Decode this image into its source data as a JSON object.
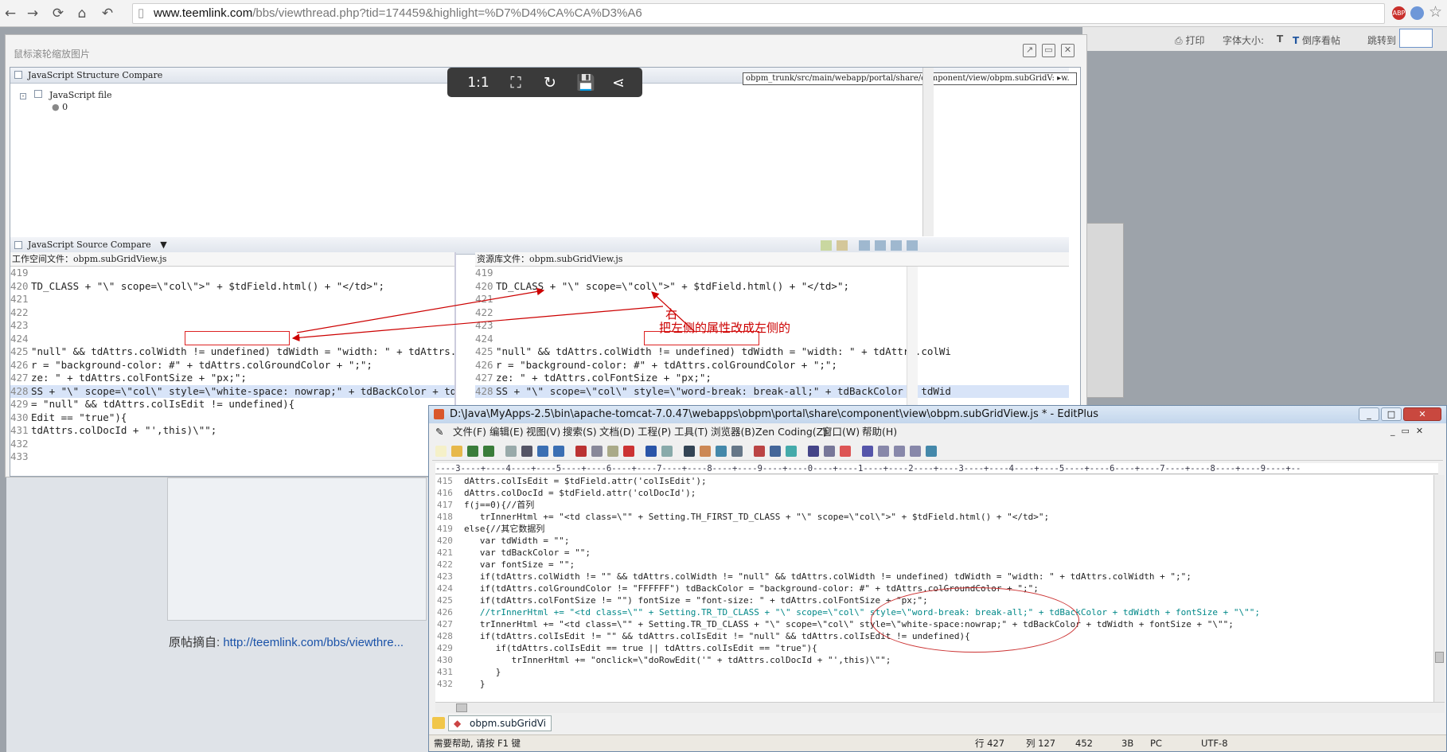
{
  "browser": {
    "url_host": "www.teemlink.com",
    "url_path": "/bbs/viewthread.php?tid=174459&highlight=%D7%D4%CA%CA%D3%A6"
  },
  "page": {
    "print": "打印",
    "font_size": "字体大小:",
    "font_t": "T",
    "reverse": "倒序看帖",
    "jump": "跳转到",
    "source_label": "原帖摘自:",
    "source_link": "http://teemlink.com/bbs/viewthre..."
  },
  "viewer": {
    "hint": "鼠标滚轮缩放图片",
    "toolbar": {
      "ratio": "1:1"
    }
  },
  "eclipse": {
    "structure_title": "JavaScript Structure Compare",
    "path": "obpm_trunk/src/main/webapp/portal/share/component/view/obpm.subGridV: ▸w.",
    "tree_root": "JavaScript file",
    "tree_child": "0",
    "source_title": "JavaScript Source Compare",
    "left_header": "工作空间文件：obpm.subGridView.js",
    "right_header": "资源库文件：obpm.subGridView.js",
    "annotation_line1": "右",
    "annotation_line2": "把左侧的属性改成左侧的",
    "left_lines": [
      {
        "n": "419",
        "t": ""
      },
      {
        "n": "420",
        "t": "TD_CLASS + \"\\\" scope=\\\"col\\\">\" + $tdField.html() + \"</td>\";"
      },
      {
        "n": "421",
        "t": ""
      },
      {
        "n": "422",
        "t": ""
      },
      {
        "n": "423",
        "t": ""
      },
      {
        "n": "424",
        "t": ""
      },
      {
        "n": "425",
        "t": "\"null\" && tdAttrs.colWidth != undefined) tdWidth = \"width: \" + tdAttrs.colWidth"
      },
      {
        "n": "426",
        "t": "r = \"background-color: #\" + tdAttrs.colGroundColor + \";\";"
      },
      {
        "n": "427",
        "t": "ze: \" + tdAttrs.colFontSize + \"px;\";"
      },
      {
        "n": "428",
        "t": "SS + \"\\\" scope=\\\"col\\\" style=\\\"white-space: nowrap;\" + tdBackColor + tdWidth + f"
      },
      {
        "n": "429",
        "t": "= \"null\" && tdAttrs.colIsEdit != undefined){"
      },
      {
        "n": "430",
        "t": "Edit == \"true\"){"
      },
      {
        "n": "431",
        "t": "tdAttrs.colDocId + \"',this)\\\"\";"
      },
      {
        "n": "432",
        "t": ""
      },
      {
        "n": "433",
        "t": ""
      }
    ],
    "right_lines": [
      {
        "n": "419",
        "t": ""
      },
      {
        "n": "420",
        "t": "TD_CLASS + \"\\\" scope=\\\"col\\\">\" + $tdField.html() + \"</td>\";"
      },
      {
        "n": "421",
        "t": ""
      },
      {
        "n": "422",
        "t": ""
      },
      {
        "n": "423",
        "t": ""
      },
      {
        "n": "424",
        "t": ""
      },
      {
        "n": "425",
        "t": "\"null\" && tdAttrs.colWidth != undefined) tdWidth = \"width: \" + tdAttrs.colWi"
      },
      {
        "n": "426",
        "t": "r = \"background-color: #\" + tdAttrs.colGroundColor + \";\";"
      },
      {
        "n": "427",
        "t": "ze: \" + tdAttrs.colFontSize + \"px;\";"
      },
      {
        "n": "428",
        "t": "SS + \"\\\" scope=\\\"col\\\" style=\\\"word-break: break-all;\" + tdBackColor + tdWid"
      }
    ]
  },
  "editplus": {
    "title": "D:\\Java\\MyApps-2.5\\bin\\apache-tomcat-7.0.47\\webapps\\obpm\\portal\\share\\component\\view\\obpm.subGridView.js * - EditPlus",
    "menu": [
      "文件(F)",
      "编辑(E)",
      "视图(V)",
      "搜索(S)",
      "文档(D)",
      "工程(P)",
      "工具(T)",
      "浏览器(B)",
      "Zen Coding(Z)",
      "窗口(W)",
      "帮助(H)"
    ],
    "ruler": "----3----+----4----+----5----+----6----+----7----+----8----+----9----+----0----+----1----+----2----+----3----+----4----+----5----+----6----+----7----+----8----+----9----+--",
    "lines": [
      {
        "n": "415",
        "t": "dAttrs.colIsEdit = $tdField.attr('colIsEdit');"
      },
      {
        "n": "416",
        "t": "dAttrs.colDocId = $tdField.attr('colDocId');"
      },
      {
        "n": "417",
        "t": "f(j==0){//首列"
      },
      {
        "n": "418",
        "t": "   trInnerHtml += \"<td class=\\\"\" + Setting.TH_FIRST_TD_CLASS + \"\\\" scope=\\\"col\\\">\" + $tdField.html() + \"</td>\";"
      },
      {
        "n": "419",
        "t": "else{//其它数据列"
      },
      {
        "n": "420",
        "t": "   var tdWidth = \"\";"
      },
      {
        "n": "421",
        "t": "   var tdBackColor = \"\";"
      },
      {
        "n": "422",
        "t": "   var fontSize = \"\";"
      },
      {
        "n": "423",
        "t": "   if(tdAttrs.colWidth != \"\" && tdAttrs.colWidth != \"null\" && tdAttrs.colWidth != undefined) tdWidth = \"width: \" + tdAttrs.colWidth + \";\";"
      },
      {
        "n": "424",
        "t": "   if(tdAttrs.colGroundColor != \"FFFFFF\") tdBackColor = \"background-color: #\" + tdAttrs.colGroundColor + \";\";"
      },
      {
        "n": "425",
        "t": "   if(tdAttrs.colFontSize != \"\") fontSize = \"font-size: \" + tdAttrs.colFontSize + \"px;\";"
      },
      {
        "n": "426",
        "t": "   //trInnerHtml += \"<td class=\\\"\" + Setting.TR_TD_CLASS + \"\\\" scope=\\\"col\\\" style=\\\"word-break: break-all;\" + tdBackColor + tdWidth + fontSize + \"\\\"\";"
      },
      {
        "n": "427",
        "t": "   trInnerHtml += \"<td class=\\\"\" + Setting.TR_TD_CLASS + \"\\\" scope=\\\"col\\\" style=\\\"white-space:nowrap;\" + tdBackColor + tdWidth + fontSize + \"\\\"\";"
      },
      {
        "n": "428",
        "t": "   if(tdAttrs.colIsEdit != \"\" && tdAttrs.colIsEdit != \"null\" && tdAttrs.colIsEdit != undefined){"
      },
      {
        "n": "429",
        "t": "      if(tdAttrs.colIsEdit == true || tdAttrs.colIsEdit == \"true\"){"
      },
      {
        "n": "430",
        "t": "         trInnerHtml += \"onclick=\\\"doRowEdit('\" + tdAttrs.colDocId + \"',this)\\\"\";"
      },
      {
        "n": "431",
        "t": "      }"
      },
      {
        "n": "432",
        "t": "   }"
      }
    ],
    "tab": "obpm.subGridVi",
    "status": {
      "help": "需要帮助, 请按 F1 键",
      "line": "行 427",
      "col": "列 127",
      "count": "452",
      "size": "3B",
      "mode": "PC",
      "encoding": "UTF-8"
    }
  }
}
